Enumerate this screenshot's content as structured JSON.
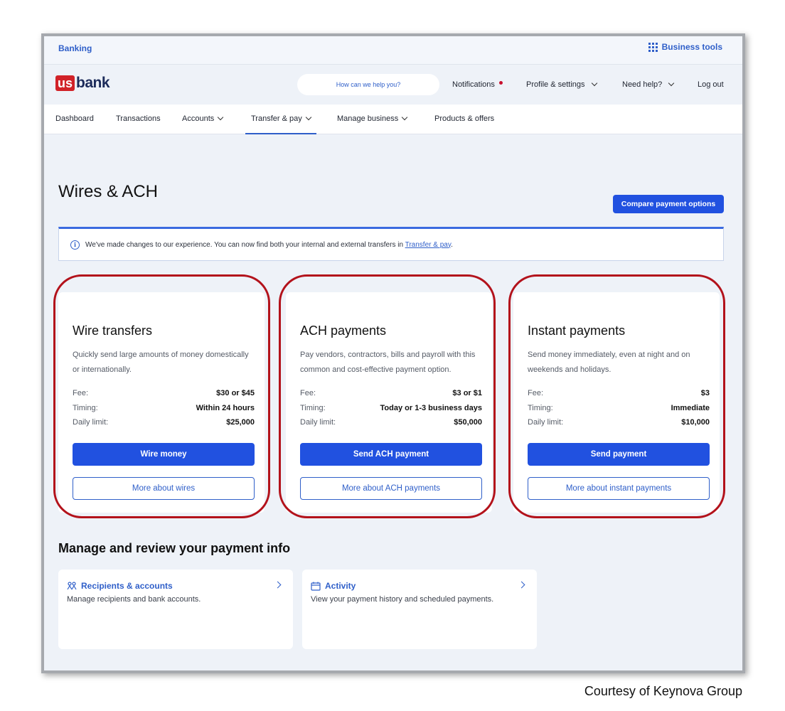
{
  "topbar": {
    "banking": "Banking",
    "business_tools": "Business tools"
  },
  "header": {
    "logo_us": "us",
    "logo_bank": "bank",
    "search_placeholder": "How can we help you?",
    "notifications": "Notifications",
    "profile": "Profile & settings",
    "help": "Need help?",
    "logout": "Log out"
  },
  "nav": {
    "items": [
      "Dashboard",
      "Transactions",
      "Accounts",
      "Transfer & pay",
      "Manage business",
      "Products & offers"
    ]
  },
  "page": {
    "title": "Wires & ACH",
    "compare_button": "Compare payment options",
    "banner_text": "We've made changes to our experience. You can now find both your internal and external transfers in ",
    "banner_link": "Transfer & pay",
    "banner_end": "."
  },
  "cards": [
    {
      "title": "Wire transfers",
      "desc": "Quickly send large amounts of money domestically or internationally.",
      "fee_label": "Fee:",
      "fee": "$30 or $45",
      "timing_label": "Timing:",
      "timing": "Within 24 hours",
      "limit_label": "Daily limit:",
      "limit": "$25,000",
      "primary": "Wire money",
      "secondary": "More about wires"
    },
    {
      "title": "ACH payments",
      "desc": "Pay vendors, contractors, bills and payroll with this common and cost-effective payment option.",
      "fee_label": "Fee:",
      "fee": "$3 or $1",
      "timing_label": "Timing:",
      "timing": "Today or 1-3 business days",
      "limit_label": "Daily limit:",
      "limit": "$50,000",
      "primary": "Send ACH payment",
      "secondary": "More about ACH payments"
    },
    {
      "title": "Instant payments",
      "desc": "Send money immediately, even at night and on weekends and holidays.",
      "fee_label": "Fee:",
      "fee": "$3",
      "timing_label": "Timing:",
      "timing": "Immediate",
      "limit_label": "Daily limit:",
      "limit": "$10,000",
      "primary": "Send payment",
      "secondary": "More about instant payments"
    }
  ],
  "manage": {
    "title": "Manage and review your payment info",
    "recipients_title": "Recipients & accounts",
    "recipients_desc": "Manage recipients and bank accounts.",
    "activity_title": "Activity",
    "activity_desc": "View your payment history and scheduled payments."
  },
  "courtesy": "Courtesy of Keynova Group",
  "colors": {
    "accent": "#2151e0",
    "highlight": "#b3121b",
    "brand_red": "#d12228"
  }
}
